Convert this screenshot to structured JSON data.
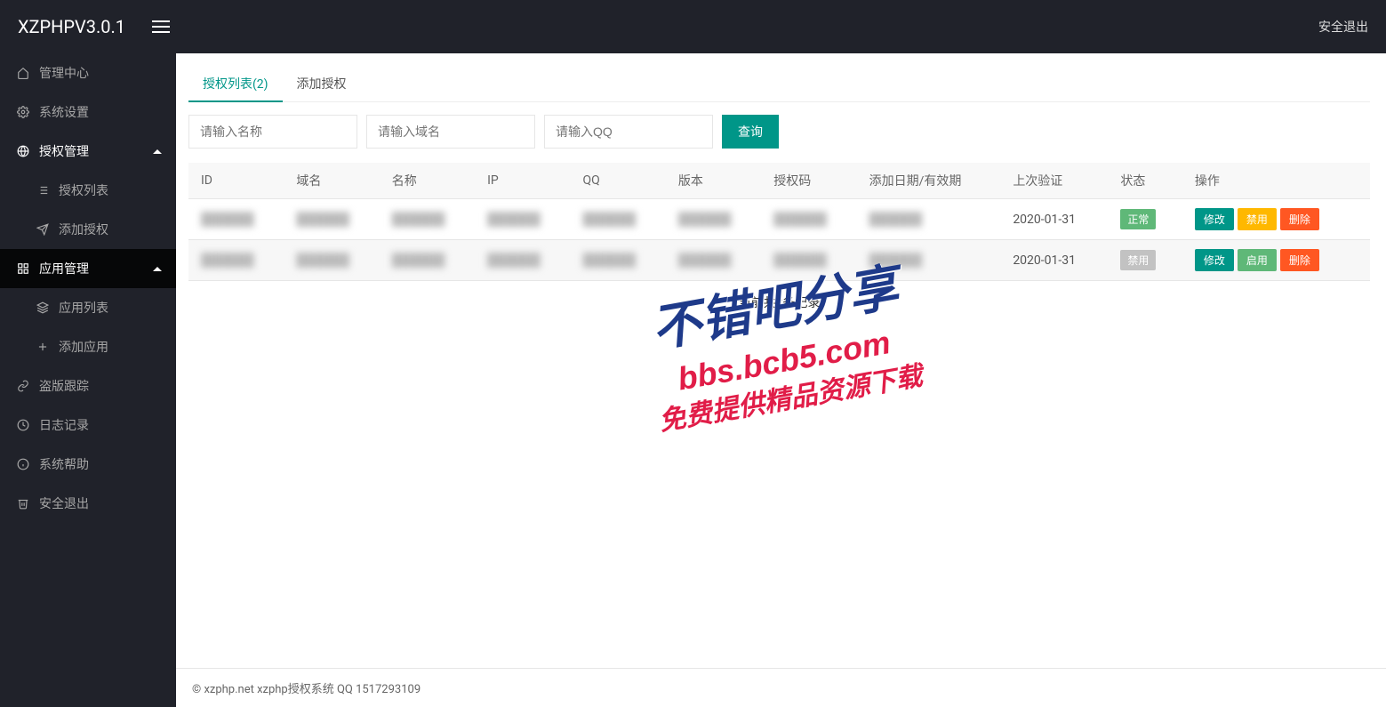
{
  "header": {
    "brand": "XZPHPV3.0.1",
    "logout": "安全退出"
  },
  "sidebar": {
    "items": [
      {
        "label": "管理中心",
        "icon": "home"
      },
      {
        "label": "系统设置",
        "icon": "gear"
      },
      {
        "label": "授权管理",
        "icon": "globe",
        "section": true,
        "expanded": true,
        "children": [
          {
            "label": "授权列表",
            "icon": "list"
          },
          {
            "label": "添加授权",
            "icon": "send"
          }
        ]
      },
      {
        "label": "应用管理",
        "icon": "grid",
        "section": true,
        "expanded": true,
        "active": true,
        "children": [
          {
            "label": "应用列表",
            "icon": "layers"
          },
          {
            "label": "添加应用",
            "icon": "plus"
          }
        ]
      },
      {
        "label": "盗版跟踪",
        "icon": "link"
      },
      {
        "label": "日志记录",
        "icon": "clock"
      },
      {
        "label": "系统帮助",
        "icon": "info"
      },
      {
        "label": "安全退出",
        "icon": "trash"
      }
    ]
  },
  "tabs": {
    "list_label": "授权列表(2)",
    "add_label": "添加授权"
  },
  "search": {
    "name_placeholder": "请输入名称",
    "domain_placeholder": "请输入域名",
    "qq_placeholder": "请输入QQ",
    "submit": "查询"
  },
  "table": {
    "headers": {
      "id": "ID",
      "domain": "域名",
      "name": "名称",
      "ip": "IP",
      "qq": "QQ",
      "version": "版本",
      "authcode": "授权码",
      "date": "添加日期/有效期",
      "last": "上次验证",
      "status": "状态",
      "action": "操作"
    },
    "rows": [
      {
        "last": "2020-01-31",
        "status": "正常",
        "status_class": "bg-greenbright",
        "actions": {
          "edit": "修改",
          "toggle": "禁用",
          "toggle_class": "bg-orange",
          "delete": "删除"
        }
      },
      {
        "last": "2020-01-31",
        "status": "禁用",
        "status_class": "bg-grey",
        "actions": {
          "edit": "修改",
          "toggle": "启用",
          "toggle_class": "bg-greenbright",
          "delete": "删除"
        }
      }
    ],
    "summary": "当前共2条记录"
  },
  "footer": {
    "text": "© xzphp.net xzphp授权系统 QQ 1517293109"
  },
  "watermark": {
    "line1": "不错吧分享",
    "line2": "bbs.bcb5.com",
    "line3": "免费提供精品资源下载"
  }
}
